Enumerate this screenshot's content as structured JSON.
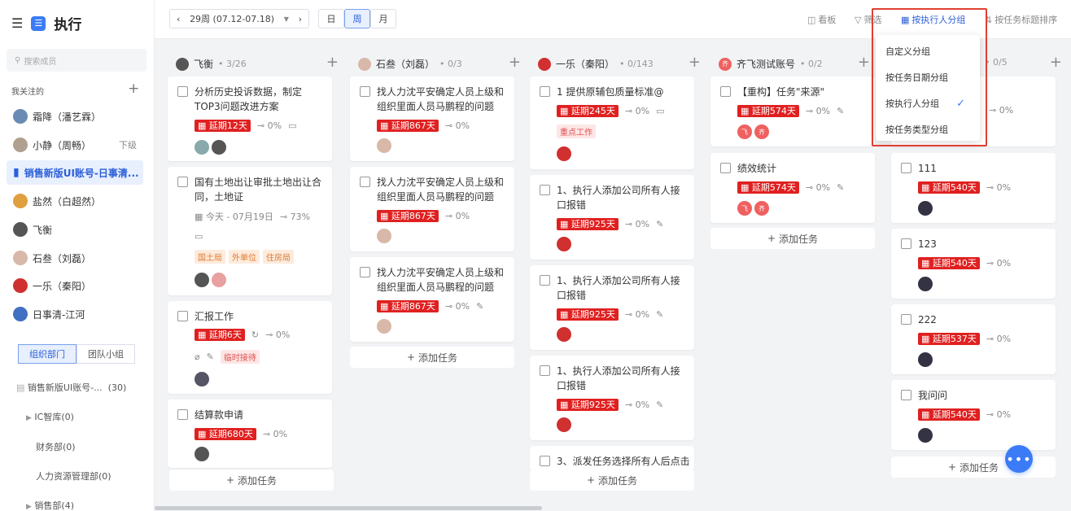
{
  "app": {
    "title": "执行"
  },
  "sidebar": {
    "search_placeholder": "搜索成员",
    "follow_title": "我关注的",
    "people": [
      {
        "name": "霜降（潘艺霖）",
        "tag": "",
        "color": "#6a8bb3"
      },
      {
        "name": "小静（周畅）",
        "tag": "下级",
        "color": "#9a8a7a"
      },
      {
        "name": "销售新版UI账号-日事清...",
        "tag": "",
        "color": "#2b5fd9"
      },
      {
        "name": "盐然（白超然）",
        "tag": "",
        "color": "#e0a040"
      },
      {
        "name": "飞衡",
        "tag": "",
        "color": "#555"
      },
      {
        "name": "石叁（刘磊）",
        "tag": "",
        "color": "#c8a090"
      },
      {
        "name": "一乐（秦阳）",
        "tag": "",
        "color": "#d03030"
      },
      {
        "name": "日事清-江河",
        "tag": "",
        "color": "#4070c0"
      }
    ],
    "tabs": [
      "组织部门",
      "团队小组"
    ],
    "org": [
      {
        "name": "销售新版UI账号-...",
        "count": "(30)"
      },
      {
        "name": "IC智库",
        "count": "(0)"
      },
      {
        "name": "财务部",
        "count": "(0)"
      },
      {
        "name": "人力资源管理部",
        "count": "(0)"
      },
      {
        "name": "销售部",
        "count": "(4)"
      }
    ]
  },
  "toolbar": {
    "week": "29周 (07.12-07.18)",
    "ranges": [
      "日",
      "周",
      "月"
    ],
    "board": "看板",
    "filter": "筛选",
    "group": "按执行人分组",
    "sort": "按任务标题排序"
  },
  "dropdown": {
    "items": [
      "自定义分组",
      "按任务日期分组",
      "按执行人分组",
      "按任务类型分组"
    ],
    "selected": "按执行人分组"
  },
  "columns": [
    {
      "name": "飞衡",
      "count": "3/26",
      "cards": [
        {
          "title": "分析历史投诉数据，制定TOP3问题改进方案",
          "delay": "延期12天",
          "pct": "0%"
        },
        {
          "title": "国有土地出让审批土地出让合同，土地证",
          "date": "今天 - 07月19日",
          "pct": "73%",
          "labels": [
            "国土局",
            "外单位",
            "住房局"
          ]
        },
        {
          "title": "汇报工作",
          "delay": "延期6天",
          "pct": "0%",
          "label": "临时接待"
        },
        {
          "title": "结算款申请",
          "delay": "延期680天",
          "pct": "0%"
        }
      ]
    },
    {
      "name": "石叁（刘磊）",
      "count": "0/3",
      "cards": [
        {
          "title": "找人力沈平安确定人员上级和组织里面人员马鹏程的问题",
          "delay": "延期867天",
          "pct": "0%"
        },
        {
          "title": "找人力沈平安确定人员上级和组织里面人员马鹏程的问题",
          "delay": "延期867天",
          "pct": "0%"
        },
        {
          "title": "找人力沈平安确定人员上级和组织里面人员马鹏程的问题",
          "delay": "延期867天",
          "pct": "0%"
        }
      ]
    },
    {
      "name": "一乐（秦阳）",
      "count": "0/143",
      "cards": [
        {
          "title": "1 提供原辅包质量标准@",
          "delay": "延期245天",
          "pct": "0%",
          "label": "重点工作"
        },
        {
          "title": "1、执行人添加公司所有人接口报错",
          "delay": "延期925天",
          "pct": "0%"
        },
        {
          "title": "1、执行人添加公司所有人接口报错",
          "delay": "延期925天",
          "pct": "0%"
        },
        {
          "title": "1、执行人添加公司所有人接口报错",
          "delay": "延期925天",
          "pct": "0%"
        },
        {
          "title": "3、派发任务选择所有人后点击"
        }
      ]
    },
    {
      "name": "齐飞测试账号",
      "count": "0/2",
      "cards": [
        {
          "title": "【重构】任务\"来源\"",
          "delay": "延期574天",
          "pct": "0%",
          "avatars": [
            "飞",
            "齐"
          ]
        },
        {
          "title": "绩效统计",
          "delay": "延期574天",
          "pct": "0%",
          "avatars": [
            "飞",
            "齐"
          ]
        }
      ]
    },
    {
      "name": "",
      "count": "0/5",
      "cards": [
        {
          "title": "",
          "pct": "0%"
        },
        {
          "title": "111",
          "delay": "延期540天",
          "pct": "0%"
        },
        {
          "title": "123",
          "delay": "延期540天",
          "pct": "0%"
        },
        {
          "title": "222",
          "delay": "延期537天",
          "pct": "0%"
        },
        {
          "title": "我问问",
          "delay": "延期540天",
          "pct": "0%"
        }
      ]
    }
  ],
  "add_task": "添加任务",
  "colors": {
    "accent": "#3b7cf6",
    "delay": "#e02020",
    "highlight": "#e04030"
  }
}
